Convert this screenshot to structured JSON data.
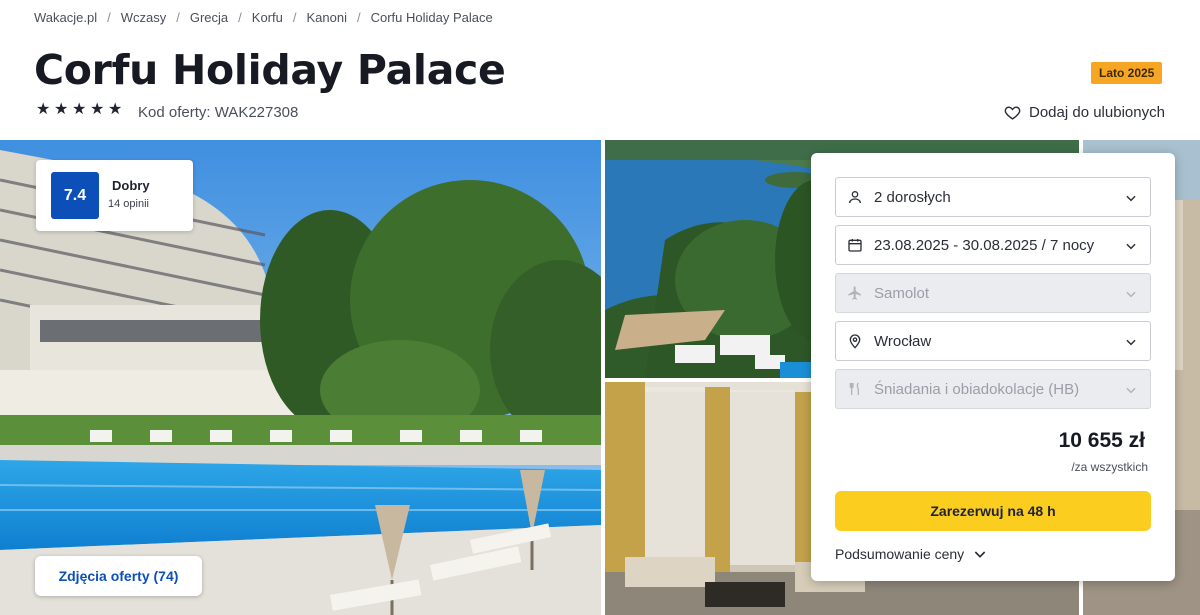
{
  "breadcrumb": [
    "Wakacje.pl",
    "Wczasy",
    "Grecja",
    "Korfu",
    "Kanoni",
    "Corfu Holiday Palace"
  ],
  "hotel": {
    "name": "Corfu Holiday Palace",
    "stars": 5,
    "offer_code": "Kod oferty: WAK227308",
    "season_badge": "Lato 2025",
    "favorite_label": "Dodaj do ulubionych"
  },
  "rating": {
    "score": "7.4",
    "label": "Dobry",
    "count": "14 opinii"
  },
  "gallery": {
    "photos_button": "Zdjęcia oferty (74)"
  },
  "booking": {
    "guests": "2 dorosłych",
    "dates": "23.08.2025 - 30.08.2025 / 7 nocy",
    "transport": "Samolot",
    "departure": "Wrocław",
    "board": "Śniadania i obiadokolacje (HB)",
    "price": "10 655 zł",
    "price_note": "/za wszystkich",
    "book_button": "Zarezerwuj na 48 h",
    "summary_label": "Podsumowanie ceny"
  },
  "colors": {
    "accent_blue": "#0d4fb8",
    "book_yellow": "#fbcd1f",
    "season_orange": "#f6a623"
  }
}
